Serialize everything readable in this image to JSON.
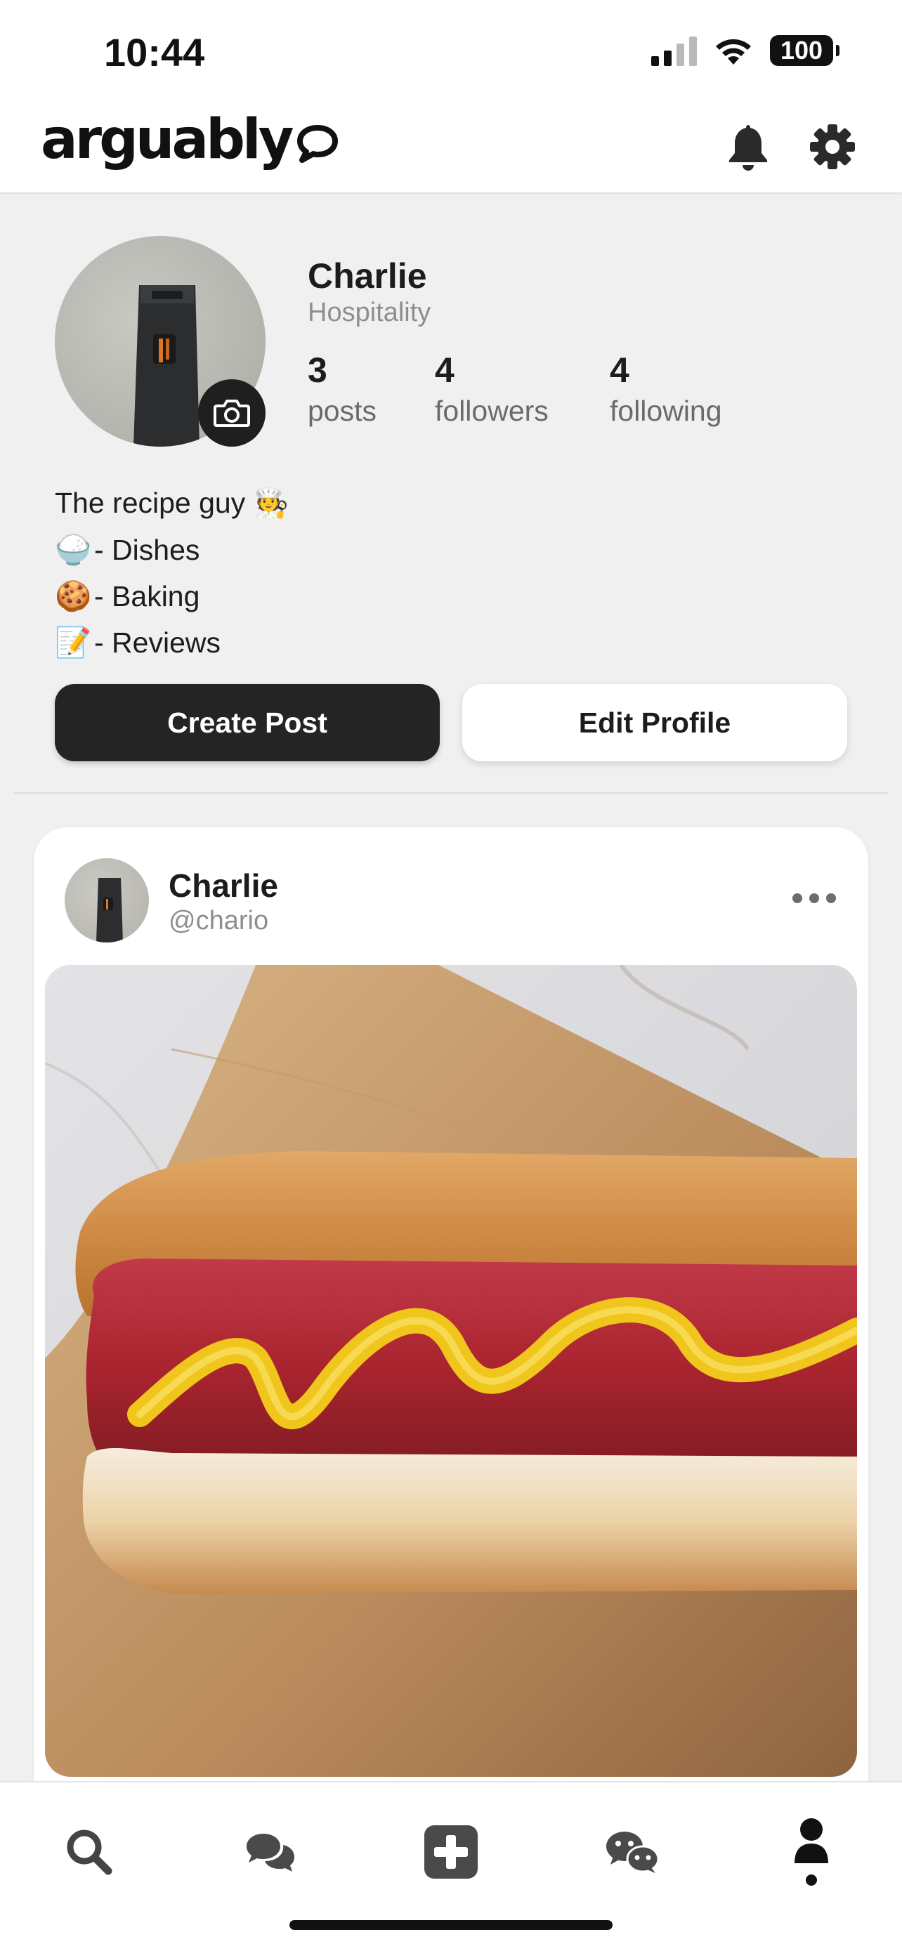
{
  "status_bar": {
    "time": "10:44",
    "battery": "100"
  },
  "header": {
    "logo_text": "arguably",
    "icons": [
      "bell-icon",
      "gear-icon"
    ]
  },
  "profile": {
    "name": "Charlie",
    "role": "Hospitality",
    "stats": [
      {
        "value": "3",
        "label": "posts"
      },
      {
        "value": "4",
        "label": "followers"
      },
      {
        "value": "4",
        "label": "following"
      }
    ],
    "bio": [
      {
        "emoji": "",
        "text": "The recipe guy 🧑‍🍳"
      },
      {
        "emoji": "🍚",
        "text": "- Dishes"
      },
      {
        "emoji": "🍪",
        "text": "- Baking"
      },
      {
        "emoji": "📝",
        "text": "- Reviews"
      }
    ],
    "buttons": {
      "create_post": "Create Post",
      "edit_profile": "Edit Profile"
    }
  },
  "post": {
    "author_name": "Charlie",
    "author_handle": "@chario",
    "image_subject": "hot dog with mustard on a wooden board"
  },
  "tab_bar": {
    "items": [
      "search-icon",
      "chat-bubbles-icon",
      "plus-square-icon",
      "wechat-icon",
      "profile-icon"
    ],
    "active": "profile-icon"
  },
  "colors": {
    "background": "#f0f0f0",
    "primary_button": "#242424",
    "text_primary": "#1c1c1c",
    "text_secondary": "#8e8e8e"
  }
}
